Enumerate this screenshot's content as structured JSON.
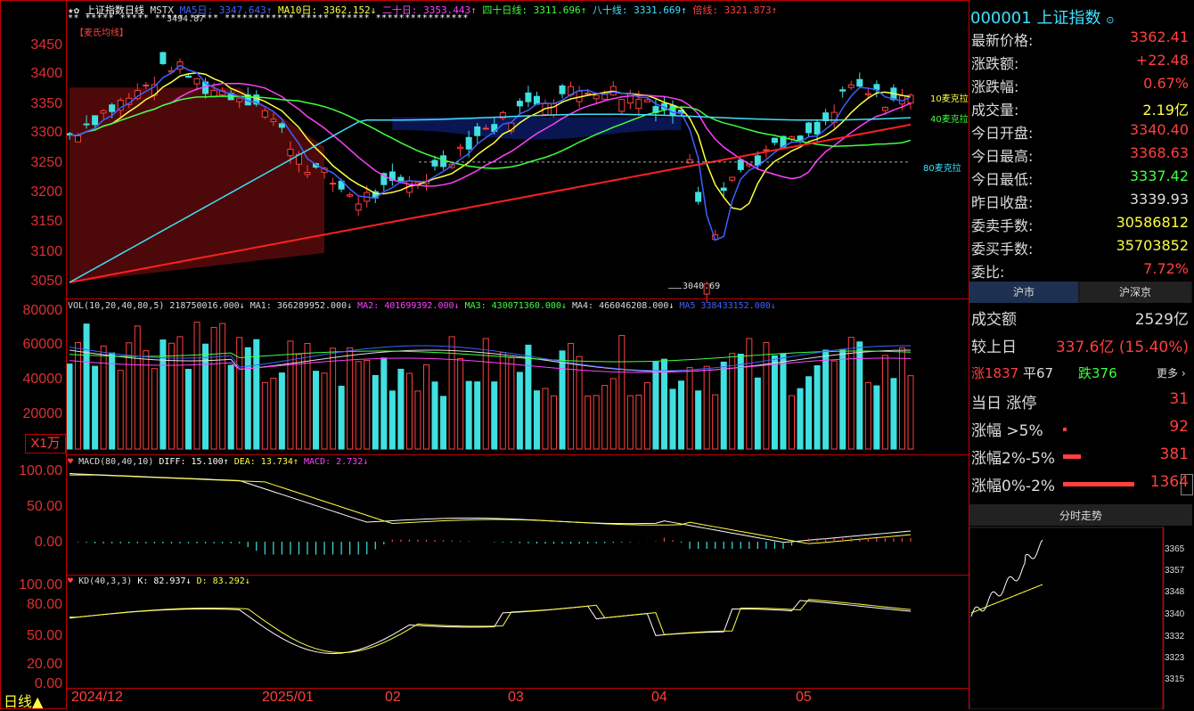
{
  "header": {
    "icons": "★✿",
    "title": "上证指数日线",
    "indicator": "MSTX",
    "ma5": "MA5日: 3347.643↑",
    "ma10": "MA10日: 3362.152↓",
    "ma20": "二十日: 3353.443↑",
    "ma40": "四十日线: 3311.696↑",
    "ma80": "八十线: 3331.669↑",
    "ma_long": "倍线: 3321.873↑",
    "stars_row": "**  *****  *****  *****       *****  ************  *****  ******  ****************",
    "high_mark": "3494.87",
    "mai_label": "【麦氏均线】"
  },
  "price_axis": [
    "3450",
    "3400",
    "3350",
    "3300",
    "3250",
    "3200",
    "3150",
    "3100",
    "3050"
  ],
  "price_annotations": {
    "low": "3040.69",
    "line10": "10麦克拉",
    "line40": "40麦克拉",
    "line80": "80麦克拉"
  },
  "volume": {
    "legend_main": "VOL(10,20,40,80,5)  218750016.000↓",
    "ma1": "MA1: 366289952.000↓",
    "ma2": "MA2: 401699392.000↓",
    "ma3": "MA3: 430071360.000↓",
    "ma4": "MA4: 466046208.000↓",
    "ma5": "MA5  338433152.000↓",
    "axis": [
      "80000",
      "60000",
      "40000",
      "20000"
    ],
    "unit": "X1万"
  },
  "macd": {
    "legend": "MACD(80,40,10)",
    "diff": "DIFF: 15.100↑",
    "dea": "DEA: 13.734↑",
    "macd": "MACD: 2.732↓",
    "axis": [
      "100.00",
      "50.00",
      "0.00"
    ]
  },
  "kd": {
    "legend": "KD(40,3,3)",
    "k": "K: 82.937↓",
    "d": "D: 83.292↓",
    "axis": [
      "100.00",
      "80.00",
      "50.00",
      "20.00",
      "0.00"
    ]
  },
  "bottom_bar": {
    "period_label": "日线▲",
    "dates": [
      "2024/12",
      "2025/01",
      "02",
      "03",
      "04",
      "05"
    ]
  },
  "quote": {
    "code": "000001",
    "name": "上证指数",
    "rows": [
      {
        "label": "最新价格:",
        "value": "3362.41",
        "color": "#ff4040"
      },
      {
        "label": "涨跌额:",
        "value": "+22.48",
        "color": "#ff4040"
      },
      {
        "label": "涨跌幅:",
        "value": "0.67%",
        "color": "#ff4040"
      },
      {
        "label": "成交量:",
        "value": "2.19亿",
        "color": "#ffff40"
      },
      {
        "label": "今日开盘:",
        "value": "3340.40",
        "color": "#ff4040"
      },
      {
        "label": "今日最高:",
        "value": "3368.63",
        "color": "#ff4040"
      },
      {
        "label": "今日最低:",
        "value": "3337.42",
        "color": "#40ff40"
      },
      {
        "label": "昨日收盘:",
        "value": "3339.93",
        "color": "#dddddd"
      },
      {
        "label": "委卖手数:",
        "value": "30586812",
        "color": "#ffff40"
      },
      {
        "label": "委买手数:",
        "value": "35703852",
        "color": "#ffff40"
      },
      {
        "label": "委比:",
        "value": "7.72%",
        "color": "#ff4040"
      }
    ]
  },
  "tabs": {
    "t1": "沪市",
    "t2": "沪深京"
  },
  "market": {
    "turnover_label": "成交额",
    "turnover_value": "2529亿",
    "vs_label": "较上日",
    "vs_value": "337.6亿 (15.40%)",
    "up_label": "涨",
    "up_count": "1837",
    "flat_label": "平",
    "flat_count": "67",
    "down_label": "跌",
    "down_count": "376",
    "more": "更多",
    "limit_up_label": "当日 涨停",
    "limit_up_value": "31",
    "gt5_label": "涨幅 >5%",
    "gt5_value": "92",
    "r2_5_label": "涨幅2%-5%",
    "r2_5_value": "381",
    "r0_2_label": "涨幅0%-2%",
    "r0_2_value": "1364"
  },
  "intraday": {
    "title": "分时走势",
    "axis": [
      "3365",
      "3357",
      "3348",
      "3340",
      "3332",
      "3323",
      "3315"
    ]
  },
  "colors": {
    "bull": "#ff4040",
    "bear": "#40e0e0",
    "axis": "#c00000",
    "yellow": "#ffff40",
    "magenta": "#ff40ff",
    "green": "#40ff40",
    "cyan": "#40e0ff"
  }
}
